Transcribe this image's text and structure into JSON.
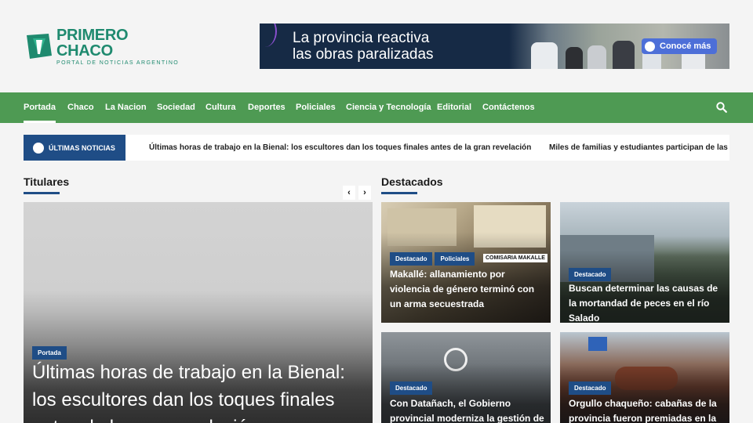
{
  "site": {
    "name": "PRIMERO CHACO",
    "tagline": "PORTAL DE NOTICIAS ARGENTINO"
  },
  "banner": {
    "line1": "La provincia reactiva",
    "line2": "las obras paralizadas",
    "cta": "Conocé más"
  },
  "nav": {
    "items": [
      "Portada",
      "Chaco",
      "La Nacion",
      "Sociedad",
      "Cultura",
      "Deportes",
      "Policiales",
      "Ciencia y Tecnología",
      "Editorial",
      "Contáctenos"
    ],
    "active": "Portada"
  },
  "ticker": {
    "label": "ÚLTIMAS NOTICIAS",
    "items": [
      "Últimas horas de trabajo en la Bienal: los escultores dan los toques finales antes de la gran revelación",
      "Miles de familias y estudiantes participan de las pr"
    ]
  },
  "titulares": {
    "heading": "Titulares",
    "hero": {
      "category": "Portada",
      "title": "Últimas horas de trabajo en la Bienal: los escultores dan los toques finales antes de la gran revelación"
    }
  },
  "destacados": {
    "heading": "Destacados",
    "cards": [
      {
        "categories": [
          "Destacado",
          "Policiales"
        ],
        "title": "Makallé: allanamiento por violencia de género terminó con un arma secuestrada",
        "image_caption": "COMISARIA MAKALLE"
      },
      {
        "categories": [
          "Destacado"
        ],
        "title": "Buscan determinar las causas de la mortandad de peces en el río Salado"
      },
      {
        "categories": [
          "Destacado"
        ],
        "title": "Con Datañach, el Gobierno provincial moderniza la gestión de"
      },
      {
        "categories": [
          "Destacado"
        ],
        "title": "Orgullo chaqueño: cabañas de la provincia fueron premiadas en la"
      }
    ]
  },
  "colors": {
    "nav_green": "#4e9a53",
    "accent_blue": "#1f4d86",
    "logo_green": "#1f8a6f"
  }
}
